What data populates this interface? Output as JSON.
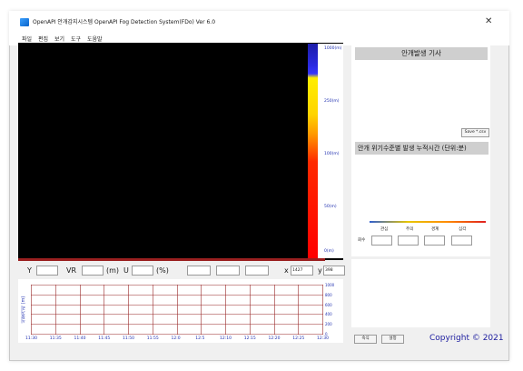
{
  "window": {
    "title": "OpenAPI 안개감지시스템 OpenAPI Fog Detection System(FDo) Ver 6.0",
    "close_glyph": "✕"
  },
  "menu": [
    "파일",
    "편집",
    "보기",
    "도구",
    "도움말"
  ],
  "colorbar": {
    "labels": [
      "1000(m)",
      "250(m)",
      "100(m)",
      "50(m)",
      "0(m)"
    ]
  },
  "right_panel": {
    "header": "안개발생 기사",
    "save_label": "Save *.csv",
    "header2": "안개 위기수준별 발생 누적시간 (단위:분)",
    "levels": [
      "관심",
      "주의",
      "경계",
      "심각"
    ],
    "level_colors": [
      "#2f5fd0",
      "#e8c600",
      "#ff8c00",
      "#e02020"
    ],
    "row_label": "회수"
  },
  "controls": {
    "y_label": "Y",
    "vr_label": "VR",
    "vr_unit": "(m)",
    "u_label": "U",
    "u_unit": "(%)",
    "x_label": "x",
    "x_value": "1427",
    "y2_label": "y",
    "y2_value": "398"
  },
  "graph": {
    "ylabel": "시정거리 (m)",
    "yticks": [
      "1000",
      "800",
      "600",
      "400",
      "200",
      "0"
    ],
    "xticks": [
      "11:30",
      "11:35",
      "11:40",
      "11:45",
      "11:50",
      "11:55",
      "12:0",
      "12:5",
      "12:10",
      "12:15",
      "12:20",
      "12:25",
      "12:30"
    ],
    "grid_color": "#9a2a2a"
  },
  "bottom": {
    "btn1": "숙식",
    "btn2": "설정",
    "copyright": "Copyright © 2021"
  }
}
